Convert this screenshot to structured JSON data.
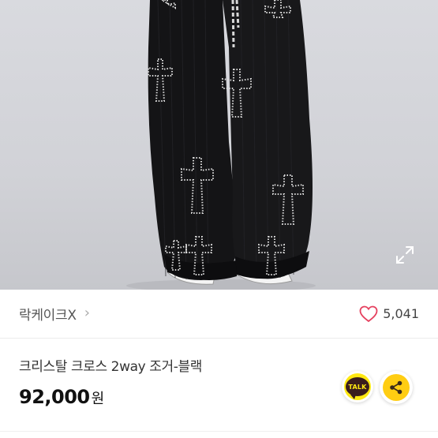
{
  "product_image": {
    "alt": "",
    "expand_icon": "expand-arrows-icon"
  },
  "store": {
    "name": "락케이크X",
    "chevron": "›",
    "like_icon": "heart-outline-icon",
    "like_count": "5,041",
    "accent_color": "#e5405e"
  },
  "product": {
    "title": "크리스탈 크로스 2way 조거-블랙",
    "price": "92,000",
    "currency": "원"
  },
  "actions": {
    "talk_label": "TALK",
    "talk_color": "#ffe812",
    "share_icon": "share-icon",
    "share_color": "#ffcd12"
  }
}
